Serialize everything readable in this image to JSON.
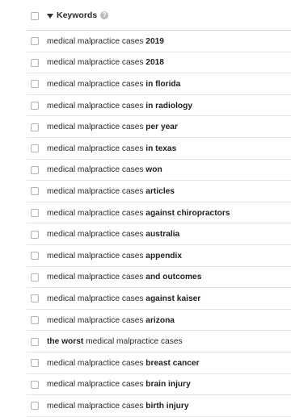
{
  "header": {
    "label": "Keywords",
    "help_glyph": "?",
    "sort_icon": "caret-down-icon"
  },
  "rows": [
    {
      "pre": "medical malpractice cases ",
      "mod": "2019",
      "post": ""
    },
    {
      "pre": "medical malpractice cases ",
      "mod": "2018",
      "post": ""
    },
    {
      "pre": "medical malpractice cases ",
      "mod": "in florida",
      "post": ""
    },
    {
      "pre": "medical malpractice cases ",
      "mod": "in radiology",
      "post": ""
    },
    {
      "pre": "medical malpractice cases ",
      "mod": "per year",
      "post": ""
    },
    {
      "pre": "medical malpractice cases ",
      "mod": "in texas",
      "post": ""
    },
    {
      "pre": "medical malpractice cases ",
      "mod": "won",
      "post": ""
    },
    {
      "pre": "medical malpractice cases ",
      "mod": "articles",
      "post": ""
    },
    {
      "pre": "medical malpractice cases ",
      "mod": "against chiropractors",
      "post": ""
    },
    {
      "pre": "medical malpractice cases ",
      "mod": "australia",
      "post": ""
    },
    {
      "pre": "medical malpractice cases ",
      "mod": "appendix",
      "post": ""
    },
    {
      "pre": "medical malpractice cases ",
      "mod": "and outcomes",
      "post": ""
    },
    {
      "pre": "medical malpractice cases ",
      "mod": "against kaiser",
      "post": ""
    },
    {
      "pre": "medical malpractice cases ",
      "mod": "arizona",
      "post": ""
    },
    {
      "pre": "",
      "mod": "the worst",
      "post": " medical malpractice cases"
    },
    {
      "pre": "medical malpractice cases ",
      "mod": "breast cancer",
      "post": ""
    },
    {
      "pre": "medical malpractice cases ",
      "mod": "brain injury",
      "post": ""
    },
    {
      "pre": "medical malpractice cases ",
      "mod": "birth injury",
      "post": ""
    }
  ]
}
